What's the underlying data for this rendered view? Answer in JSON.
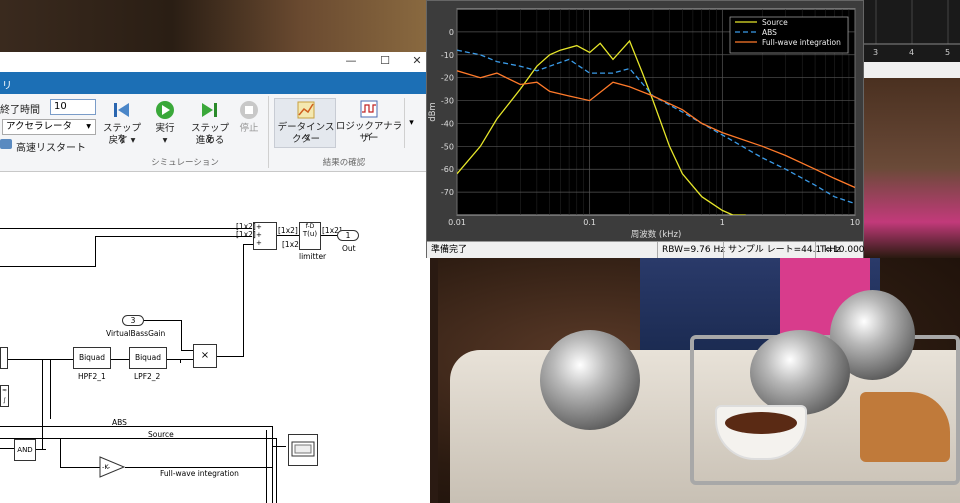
{
  "simulink": {
    "tab_title": "リ",
    "window_buttons": {
      "minimize": "—",
      "maximize": "☐",
      "close": "✕"
    },
    "quick_access": [
      "💾",
      "↶",
      "↷",
      "?",
      "▾"
    ],
    "ribbon": {
      "stop_time_label": "終了時間",
      "stop_time_value": "10",
      "mode_value": "アクセラレータ",
      "fast_restart_label": "高速リスタート",
      "step_back_label_1": "ステップを",
      "step_back_label_2": "戻す ▾",
      "run_label_1": "実行",
      "run_label_2": "▾",
      "step_forward_label_1": "ステップを",
      "step_forward_label_2": "進める",
      "stop_label": "停止",
      "simulation_section": "シミュレーション",
      "data_inspector_label_1": "データインスペ",
      "data_inspector_label_2": "クター",
      "logic_analyzer_label_1": "ロジックアナライ",
      "logic_analyzer_label_2": "ザー",
      "results_section": "結果の確認"
    },
    "diagram": {
      "port_1x2_a": "[1x2]",
      "port_1x2_b": "[1x2]",
      "port_1x2_c": "[1x2]",
      "port_1x2_d": "[1x2]",
      "port_1x2_e": "[1x2]",
      "limitter_block": "T(u)",
      "limitter_label": "limitter",
      "out_block": "1",
      "out_label": "Out",
      "vbg_block": "3",
      "vbg_label": "VirtualBassGain",
      "hpf_block": "Biquad",
      "hpf_label": "HPF2_1",
      "lpf_block": "Biquad",
      "lpf_label": "LPF2_2",
      "mult_block": "×",
      "and_block": "AND",
      "gain_block": "-K-",
      "abs_label": "ABS",
      "source_label": "Source",
      "fwi_label": "Full-wave integration"
    }
  },
  "scope": {
    "ylabel": "dBm",
    "xlabel": "周波数 (kHz)",
    "status_ready": "準備完了",
    "status_rbw": "RBW=9.76 Hz",
    "status_fs": "サンプル レート=44.1 kHz",
    "status_t": "T=10.000"
  },
  "scope2": {
    "ticks": [
      "3",
      "4",
      "5"
    ]
  },
  "chart_data": {
    "type": "line",
    "title": "",
    "xlabel": "周波数 (kHz)",
    "ylabel": "dBm",
    "xscale": "log",
    "xlim": [
      0.01,
      10
    ],
    "ylim": [
      -80,
      10
    ],
    "xticks": [
      0.01,
      0.1,
      1,
      10
    ],
    "xtick_labels": [
      "0.01",
      "0.1",
      "1",
      "10"
    ],
    "yticks": [
      0,
      -10,
      -20,
      -30,
      -40,
      -50,
      -60,
      -70
    ],
    "ytick_labels": [
      "0",
      "-10",
      "-20",
      "-30",
      "-40",
      "-50",
      "-60",
      "-70"
    ],
    "grid": true,
    "legend_position": "top-right",
    "background": "#000000",
    "series": [
      {
        "name": "Source",
        "color": "#e6e62a",
        "style": "solid",
        "x": [
          0.01,
          0.015,
          0.02,
          0.03,
          0.04,
          0.05,
          0.06,
          0.08,
          0.1,
          0.12,
          0.15,
          0.2,
          0.25,
          0.3,
          0.4,
          0.5,
          0.7,
          1,
          1.2,
          1.5
        ],
        "y": [
          -62,
          -50,
          -38,
          -25,
          -15,
          -10,
          -8,
          -6,
          -9,
          -5,
          -12,
          -4,
          -18,
          -30,
          -50,
          -62,
          -72,
          -78,
          -80,
          -80
        ]
      },
      {
        "name": "ABS",
        "color": "#3a9be8",
        "style": "dashed",
        "x": [
          0.01,
          0.015,
          0.02,
          0.03,
          0.04,
          0.05,
          0.07,
          0.1,
          0.15,
          0.2,
          0.3,
          0.5,
          0.7,
          1,
          2,
          3,
          5,
          7,
          10
        ],
        "y": [
          -8,
          -10,
          -13,
          -15,
          -17,
          -15,
          -12,
          -18,
          -18,
          -16,
          -28,
          -35,
          -40,
          -45,
          -55,
          -60,
          -67,
          -72,
          -75
        ]
      },
      {
        "name": "Full-wave integration",
        "color": "#ff7a2a",
        "style": "solid",
        "x": [
          0.01,
          0.015,
          0.02,
          0.03,
          0.04,
          0.05,
          0.07,
          0.1,
          0.15,
          0.2,
          0.3,
          0.5,
          0.7,
          1,
          2,
          3,
          5,
          7,
          10
        ],
        "y": [
          -17,
          -20,
          -18,
          -23,
          -22,
          -26,
          -28,
          -30,
          -22,
          -24,
          -28,
          -34,
          -40,
          -44,
          -50,
          -54,
          -60,
          -64,
          -68
        ]
      }
    ]
  }
}
